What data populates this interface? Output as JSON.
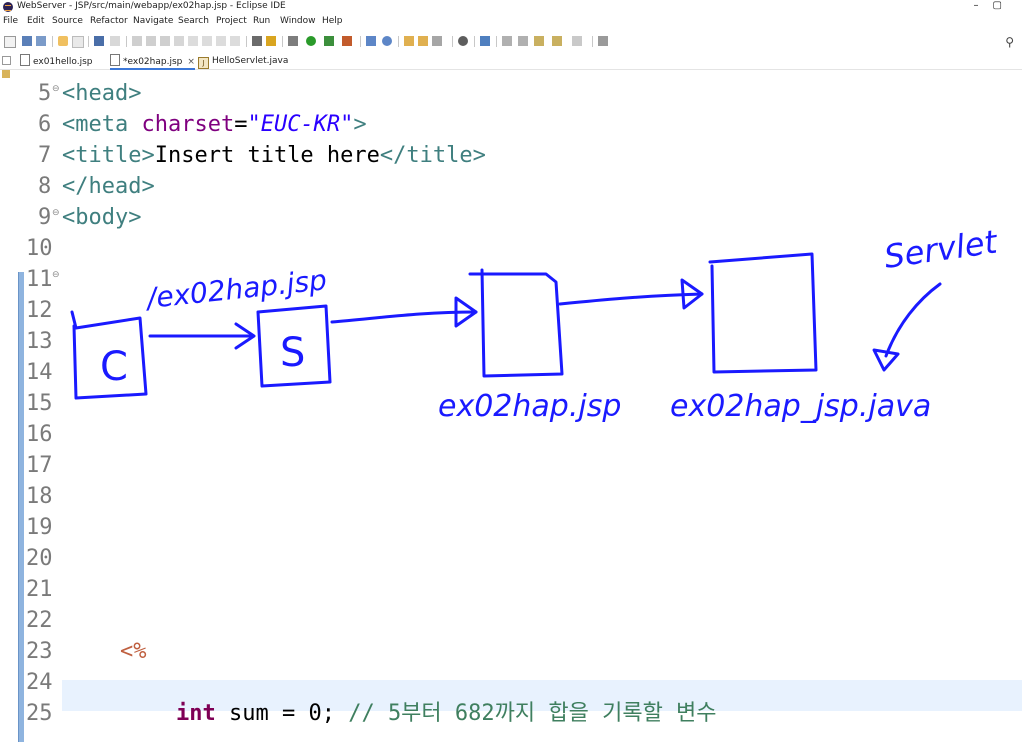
{
  "window": {
    "title": "WebServer - JSP/src/main/webapp/ex02hap.jsp - Eclipse IDE",
    "minimize": "–",
    "maximize": "▢"
  },
  "menu": [
    "File",
    "Edit",
    "Source",
    "Refactor",
    "Navigate",
    "Search",
    "Project",
    "Run",
    "Window",
    "Help"
  ],
  "toolbar": {
    "search_icon": "search-icon"
  },
  "tabs": [
    {
      "label": "ex01hello.jsp",
      "icon": "jsp-file-icon"
    },
    {
      "label": "*ex02hap.jsp",
      "icon": "jsp-file-icon",
      "close": "×"
    },
    {
      "label": "HelloServlet.java",
      "icon": "java-file-icon"
    }
  ],
  "editor": {
    "line_numbers": [
      "5",
      "6",
      "7",
      "8",
      "9",
      "10",
      "11",
      "12",
      "13",
      "14",
      "15",
      "16",
      "17",
      "18",
      "19",
      "20",
      "21",
      "22",
      "23",
      "24",
      "25"
    ],
    "fold_marker": "⊖",
    "lines": {
      "l5": {
        "open": "<",
        "tag": "head",
        "close": ">"
      },
      "l6": {
        "open": "<",
        "tag": "meta",
        "attr": "charset",
        "eq": "=",
        "value": "\"EUC-KR\"",
        "close": ">"
      },
      "l7": {
        "open": "<",
        "tag": "title",
        "close": ">",
        "text": "Insert title here",
        "end_open": "</",
        "end_tag": "title",
        "end_close": ">"
      },
      "l8": {
        "open": "</",
        "tag": "head",
        "close": ">"
      },
      "l9": {
        "open": "<",
        "tag": "body",
        "close": ">"
      },
      "l23": {
        "scriptlet": "<%"
      },
      "l25": {
        "keyword": "int",
        "code": " sum = 0; ",
        "comment": "// 5부터 682까지 합을 기록할 변수"
      }
    }
  },
  "annotations": {
    "client": "C",
    "server": "S",
    "arrow_label": "/ex02hap.jsp",
    "jsp_box_label": "ex02hap.jsp",
    "java_box_label": "ex02hap_jsp.java",
    "servlet_label": "Servlet",
    "ink_color": "#1a1aff"
  }
}
